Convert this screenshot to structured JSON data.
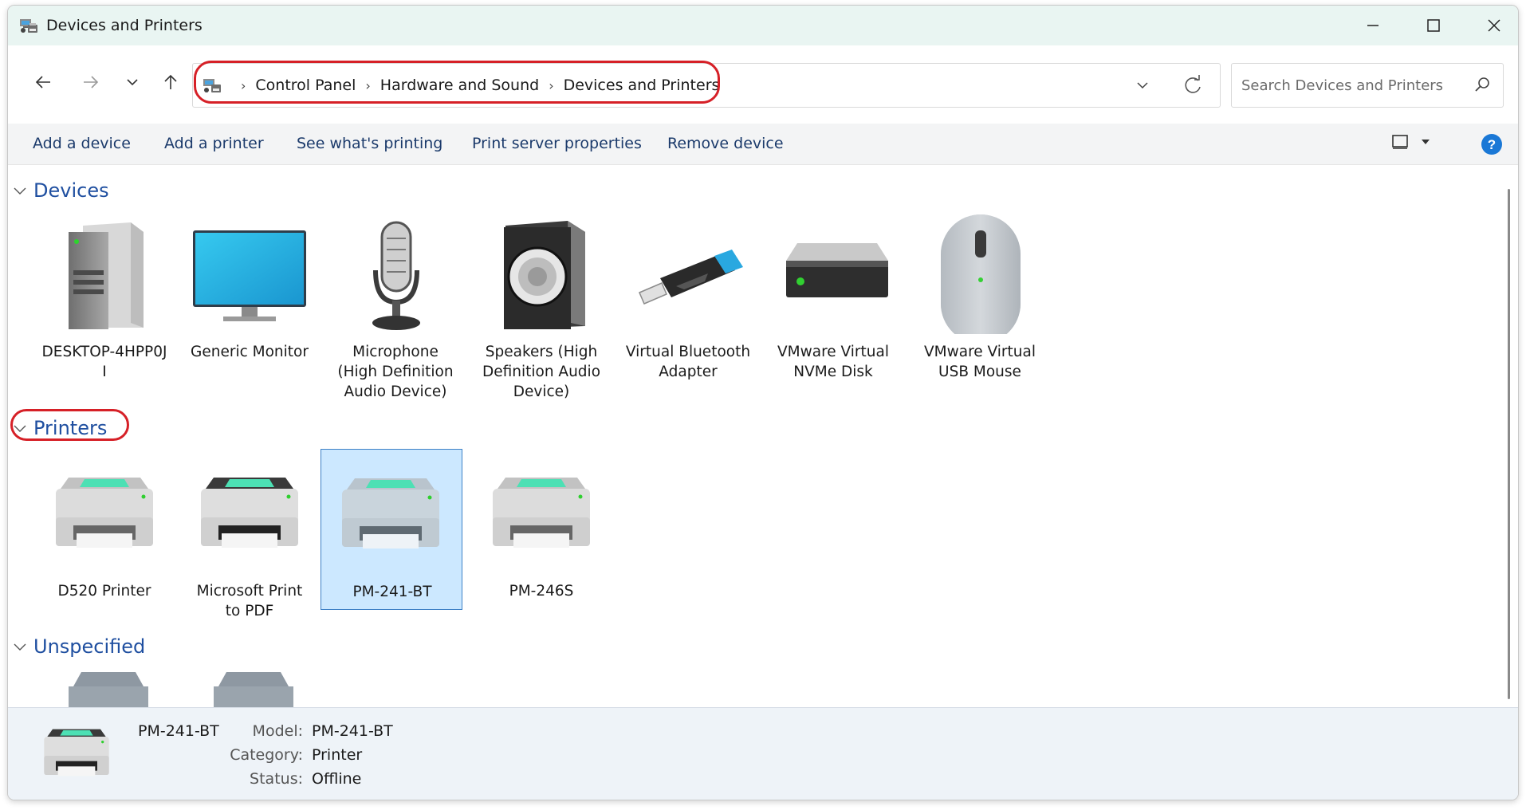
{
  "window": {
    "title": "Devices and Printers"
  },
  "address": {
    "crumbs": [
      "Control Panel",
      "Hardware and Sound",
      "Devices and Printers"
    ]
  },
  "search": {
    "placeholder": "Search Devices and Printers"
  },
  "commands": [
    "Add a device",
    "Add a printer",
    "See what's printing",
    "Print server properties",
    "Remove device"
  ],
  "groups": {
    "devices": {
      "label": "Devices",
      "items": [
        {
          "name": "DESKTOP-4HPP0J\nI",
          "icon": "server-tower-icon"
        },
        {
          "name": "Generic Monitor",
          "icon": "monitor-icon"
        },
        {
          "name": "Microphone\n(High Definition\nAudio Device)",
          "icon": "microphone-icon"
        },
        {
          "name": "Speakers (High\nDefinition Audio\nDevice)",
          "icon": "speaker-icon"
        },
        {
          "name": "Virtual Bluetooth\nAdapter",
          "icon": "usb-dongle-icon"
        },
        {
          "name": "VMware Virtual\nNVMe Disk",
          "icon": "disk-drive-icon"
        },
        {
          "name": "VMware Virtual\nUSB Mouse",
          "icon": "mouse-icon"
        }
      ]
    },
    "printers": {
      "label": "Printers",
      "items": [
        {
          "name": "D520 Printer",
          "icon": "printer-icon"
        },
        {
          "name": "Microsoft Print\nto PDF",
          "icon": "printer-dark-icon"
        },
        {
          "name": "PM-241-BT",
          "icon": "printer-icon",
          "selected": true
        },
        {
          "name": "PM-246S",
          "icon": "printer-icon"
        }
      ]
    },
    "unspecified": {
      "label": "Unspecified"
    }
  },
  "details": {
    "name": "PM-241-BT",
    "model_label": "Model:",
    "model": "PM-241-BT",
    "category_label": "Category:",
    "category": "Printer",
    "status_label": "Status:",
    "status": "Offline"
  },
  "colors": {
    "accent": "#1f4fa0",
    "annotation": "#d62027",
    "selection": "#cce8ff"
  }
}
